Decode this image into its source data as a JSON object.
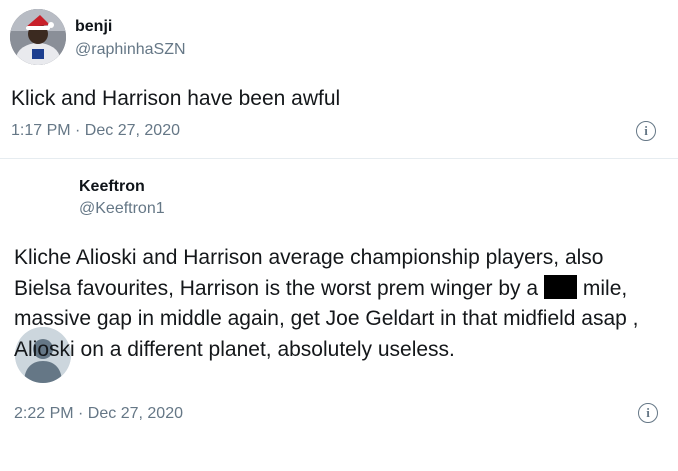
{
  "tweet1": {
    "display_name": "benji",
    "handle": "@raphinhaSZN",
    "text": "Klick and Harrison have been awful",
    "timestamp": "1:17 PM · Dec 27, 2020",
    "info_icon": "i"
  },
  "tweet2": {
    "display_name": "Keeftron",
    "handle": "@Keeftron1",
    "text_before": "Kliche Alioski and Harrison average championship players, also Bielsa favourites, Harrison is the worst prem winger by a",
    "text_after": "mile, massive gap in middle again, get Joe Geldart in that midfield asap , Alioski on a different planet, absolutely useless.",
    "timestamp": "2:22 PM · Dec 27, 2020",
    "info_icon": "i"
  },
  "colors": {
    "text": "#14171a",
    "secondary": "#657786",
    "divider": "#e6ecf0",
    "default_avatar_bg": "#ccd6dd",
    "default_avatar_fg": "#657786"
  }
}
